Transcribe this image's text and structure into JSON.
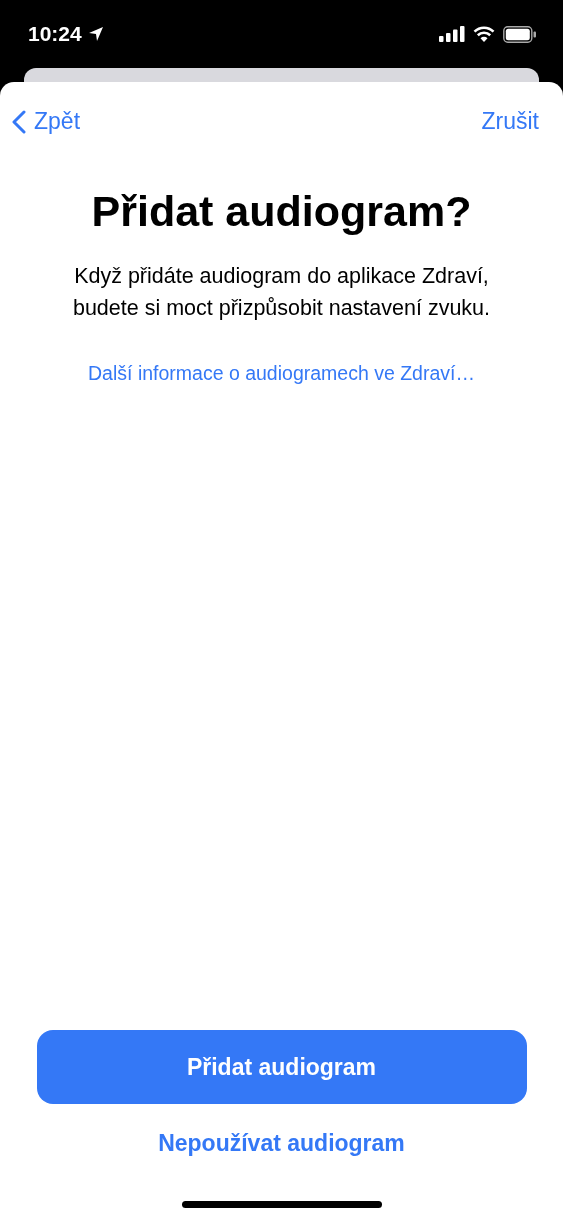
{
  "status_bar": {
    "time": "10:24"
  },
  "nav": {
    "back": "Zpět",
    "cancel": "Zrušit"
  },
  "title": "Přidat audiogram?",
  "description": "Když přidáte audiogram do aplikace Zdraví, budete si moct přizpůsobit nastavení zvuku.",
  "info_link": "Další informace o audiogramech ve Zdraví…",
  "buttons": [
    {
      "kind": "primary",
      "label": "Přidat audiogram"
    },
    {
      "kind": "secondary",
      "label": "Nepoužívat audiogram"
    }
  ]
}
